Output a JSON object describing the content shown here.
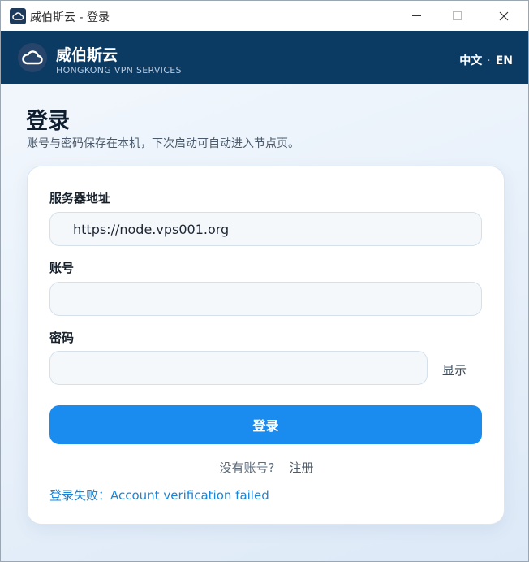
{
  "window": {
    "title": "威伯斯云 - 登录",
    "controls": [
      "minimize-icon",
      "maximize-icon",
      "close-icon"
    ]
  },
  "header": {
    "brand_name": "威伯斯云",
    "brand_sub": "HONGKONG VPN SERVICES",
    "lang_zh": "中文",
    "lang_sep": "·",
    "lang_en": "EN",
    "logo_icon": "cloud-icon"
  },
  "page": {
    "title": "登录",
    "subtitle": "账号与密码保存在本机，下次启动可自动进入节点页。"
  },
  "form": {
    "server_label": "服务器地址",
    "server_value": "https://node.vps001.org",
    "account_label": "账号",
    "account_value": "",
    "password_label": "密码",
    "password_value": "",
    "show_label": "显示",
    "login_button": "登录",
    "no_account_text": "没有账号?",
    "register_link": "注册",
    "error_message": "登录失败：Account verification failed"
  },
  "colors": {
    "header_bg": "#0b3a63",
    "primary_button": "#1a8cf0",
    "error_text": "#1a86d8"
  }
}
